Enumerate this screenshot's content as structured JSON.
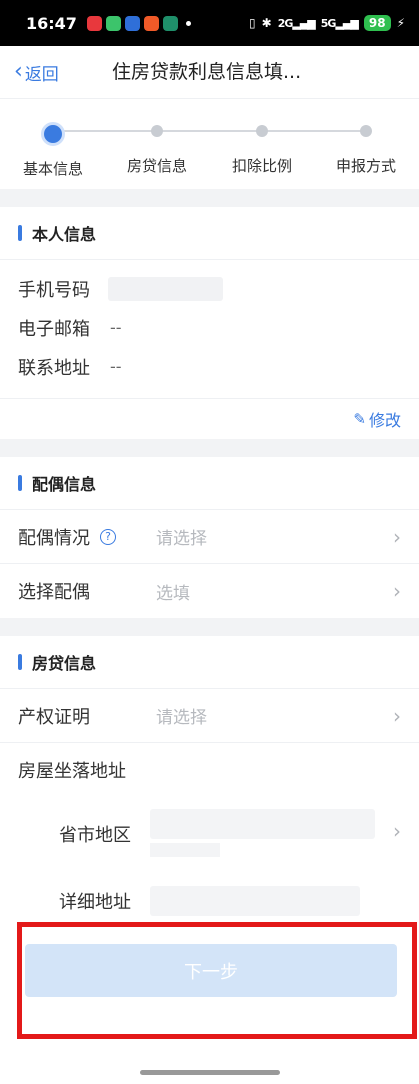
{
  "status_bar": {
    "time": "16:47",
    "signal_1": "2G",
    "signal_2": "5G",
    "battery": "98"
  },
  "nav": {
    "back_label": "返回",
    "title": "住房贷款利息信息填..."
  },
  "steps": [
    {
      "label": "基本信息",
      "active": true
    },
    {
      "label": "房贷信息",
      "active": false
    },
    {
      "label": "扣除比例",
      "active": false
    },
    {
      "label": "申报方式",
      "active": false
    }
  ],
  "personal": {
    "title": "本人信息",
    "phone_label": "手机号码",
    "email_label": "电子邮箱",
    "email_value": "--",
    "address_label": "联系地址",
    "address_value": "--",
    "edit_label": "修改"
  },
  "spouse": {
    "title": "配偶信息",
    "status_label": "配偶情况",
    "status_placeholder": "请选择",
    "select_label": "选择配偶",
    "select_placeholder": "选填"
  },
  "mortgage": {
    "title": "房贷信息",
    "deed_label": "产权证明",
    "deed_placeholder": "请选择",
    "location_label": "房屋坐落地址",
    "region_label": "省市地区",
    "detail_label": "详细地址"
  },
  "footer": {
    "next_label": "下一步"
  },
  "colors": {
    "accent": "#3a7be0",
    "highlight": "#e31919",
    "button_disabled": "#d3e4f8"
  }
}
